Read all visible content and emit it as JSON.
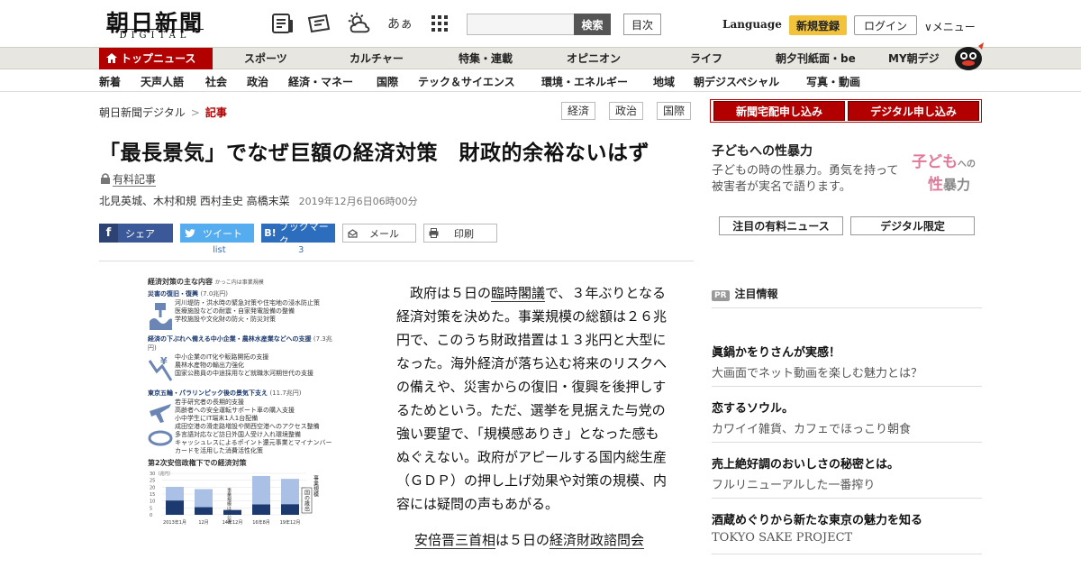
{
  "header": {
    "logo_jp": "朝日新聞",
    "logo_en": "DIGITAL",
    "search_button": "検索",
    "toc_button": "目次",
    "language": "Language",
    "signup": "新規登録",
    "login": "ログイン",
    "menu": "∨メニュー",
    "font_icon": "あぁ"
  },
  "nav_primary": [
    "トップニュース",
    "スポーツ",
    "カルチャー",
    "特集・連載",
    "オピニオン",
    "ライフ",
    "朝夕刊紙面・be",
    "MY朝デジ"
  ],
  "nav_secondary": [
    "新着",
    "天声人語",
    "社会",
    "政治",
    "経済・マネー",
    "国際",
    "テック＆サイエンス",
    "環境・エネルギー",
    "地域",
    "朝デジスペシャル",
    "写真・動画"
  ],
  "breadcrumb": {
    "home": "朝日新聞デジタル",
    "sep": ">",
    "current": "記事"
  },
  "tags": [
    "経済",
    "政治",
    "国際"
  ],
  "article": {
    "title": "「最長景気」でなぜ巨額の経済対策　財政的余裕ないはず",
    "paid_label": "有料記事",
    "authors": "北見英城、木村和規 西村圭史 高橋末菜",
    "date": "2019年12月6日06時00分",
    "paragraph1_a": "政府は５日の",
    "paragraph1_link": "臨時閣議",
    "paragraph1_b": "で、３年ぶりとなる経済対策を決めた。事業規模の総額は２６兆円で、このうち財政措置は１３兆円と大型になった。海外経済が落ち込む将来のリスクへの備えや、災害からの復旧・復興を後押しするためという。ただ、選挙を見据えた与党の強い要望で、「規模感ありき」となった感もぬぐえない。政府がアピールする国内総生産（ＧＤＰ）の押し上げ効果や対策の規模、内容には疑問の声もあがる。",
    "paragraph2_link1": "安倍晋三首相",
    "paragraph2_mid": "は５日の",
    "paragraph2_link2": "経済財政諮問会"
  },
  "share": {
    "facebook": "シェア",
    "twitter": "ツイート",
    "hatena": "ブックマーク",
    "mail": "メール",
    "print": "印刷",
    "twitter_count": "list",
    "hatena_count": "3"
  },
  "figure": {
    "heading": "経済対策の主な内容",
    "heading_note": "かっこ内は事業規模",
    "sec1_title": "災害の復旧・復興",
    "sec1_amount": "(7.0兆円)",
    "sec1_items": [
      "河川堤防・洪水時の緊急対策や住宅地の浸水防止策",
      "医療施設などの耐震・自家発電設備の整備",
      "学校施設や文化財の防火・防災対策"
    ],
    "sec2_title": "経済の下ぶれへ備える中小企業・農林水産業などへの支援",
    "sec2_amount": "(7.3兆円)",
    "sec2_items": [
      "中小企業のIT化や販路開拓の支援",
      "農林水産物の輸出力強化",
      "国家公務員の中途採用など就職氷河期世代の支援"
    ],
    "sec3_title": "東京五輪・パラリンピック後の景気下支え",
    "sec3_amount": "(11.7兆円)",
    "sec3_items": [
      "若手研究者の長期的支援",
      "高齢者への安全運転サポート車の購入支援",
      "小中学生にIT端末1人1台配備",
      "成田空港の滑走路増設や関西空港へのアクセス整備",
      "多言語対応など訪日外国人受け入れ環境整備",
      "キャッシュレスによるポイント還元事業とマイナンバーカードを活用した消費活性化策"
    ],
    "chart_title": "第2次安倍政権下での経済対策",
    "chart_unit": "30（兆円）",
    "legend_scale": "事業規模",
    "legend_nat": "国の歳出",
    "legend_none": "事業規模は非公表"
  },
  "chart_data": {
    "type": "bar",
    "title": "第2次安倍政権下での経済対策",
    "categories": [
      "2013年1月",
      "12月",
      "14年12月",
      "16年8月",
      "19年12月"
    ],
    "series": [
      {
        "name": "事業規模",
        "values": [
          20.2,
          18.6,
          0,
          28.1,
          26.0
        ]
      },
      {
        "name": "国の歳出",
        "values": [
          10.3,
          5.5,
          3.5,
          7.5,
          7.6
        ]
      }
    ],
    "ylabel": "兆円",
    "ylim": [
      0,
      30
    ],
    "yticks": [
      "30",
      "25",
      "20",
      "15",
      "10",
      "5",
      "0"
    ],
    "annotation": "事業規模は非公表"
  },
  "sidebar": {
    "subscribe_paper": "新聞宅配申し込み",
    "subscribe_digital": "デジタル申し込み",
    "promo_title": "子どもへの性暴力",
    "promo_text": "子どもの時の性暴力。勇気を持って被害者が実名で語ります。",
    "promo_art_a": "子ども",
    "promo_art_b": "への",
    "promo_art_c": "性",
    "promo_art_d": "暴力",
    "tab_paid": "注目の有料ニュース",
    "tab_digital": "デジタル限定",
    "pr_badge": "PR",
    "pr_heading": "注目情報",
    "pr_items": [
      {
        "title": "眞鍋かをりさんが実感！",
        "sub": "大画面でネット動画を楽しむ魅力とは？"
      },
      {
        "title": "恋するソウル。",
        "sub": "カワイイ雑貨、カフェでほっこり朝食"
      },
      {
        "title": "売上絶好調のおいしさの秘密とは。",
        "sub": "フルリニューアルした一番搾り"
      },
      {
        "title": "酒蔵めぐりから新たな東京の魅力を知る",
        "sub": "TOKYO SAKE PROJECT"
      }
    ]
  },
  "colors": {
    "accent_red": "#b20000",
    "signup_yellow": "#f2c33a",
    "facebook": "#3b5998",
    "twitter": "#55acee",
    "hatena": "#2c6ebd",
    "chart_navy": "#1d3a70",
    "chart_light": "#aac0e4"
  }
}
